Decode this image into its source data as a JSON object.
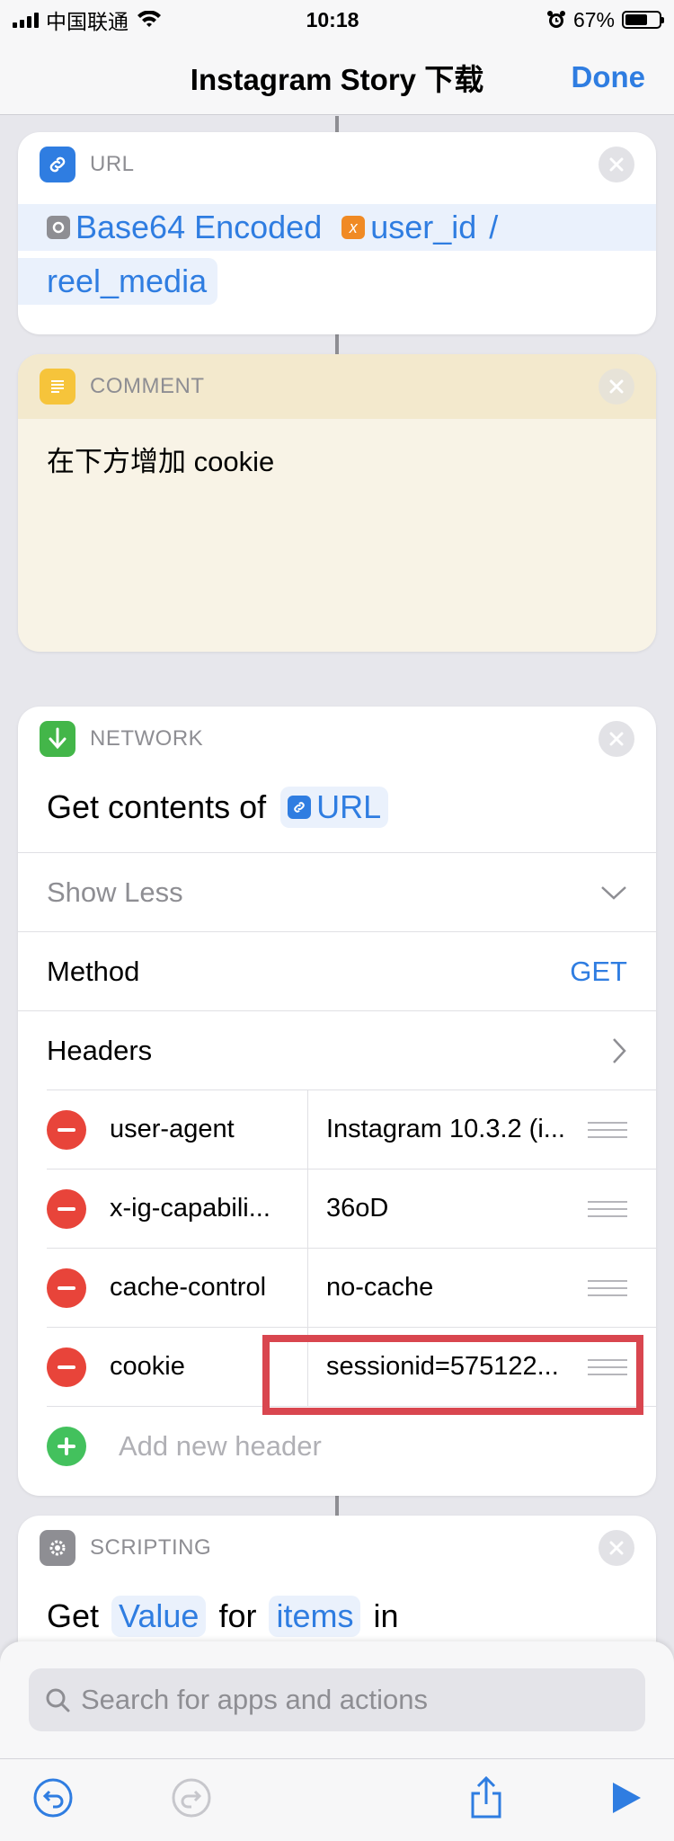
{
  "status": {
    "carrier": "中国联通",
    "time": "10:18",
    "battery": "67%",
    "battery_level": 0.67
  },
  "nav": {
    "title": "Instagram Story 下载",
    "done": "Done"
  },
  "url_card": {
    "category": "URL",
    "token1": "Base64 Encoded",
    "token2": "user_id",
    "slash": "/",
    "line2": "reel_media"
  },
  "comment_card": {
    "category": "COMMENT",
    "text": "在下方增加 cookie"
  },
  "network_card": {
    "category": "NETWORK",
    "action_prefix": "Get contents of",
    "action_token": "URL",
    "show_less": "Show Less",
    "method_label": "Method",
    "method_value": "GET",
    "headers_label": "Headers",
    "headers": [
      {
        "key": "user-agent",
        "value": "Instagram 10.3.2 (i..."
      },
      {
        "key": "x-ig-capabili...",
        "value": "36oD"
      },
      {
        "key": "cache-control",
        "value": "no-cache"
      },
      {
        "key": "cookie",
        "value": "sessionid=575122..."
      }
    ],
    "add_header": "Add new header"
  },
  "scripting_card": {
    "category": "SCRIPTING",
    "word1": "Get",
    "token1": "Value",
    "word2": "for",
    "token2": "items",
    "word3": "in"
  },
  "search": {
    "placeholder": "Search for apps and actions"
  },
  "colors": {
    "accent": "#2f7de1",
    "delete": "#e8443a",
    "add": "#43c15d",
    "highlight": "#d9464f"
  }
}
